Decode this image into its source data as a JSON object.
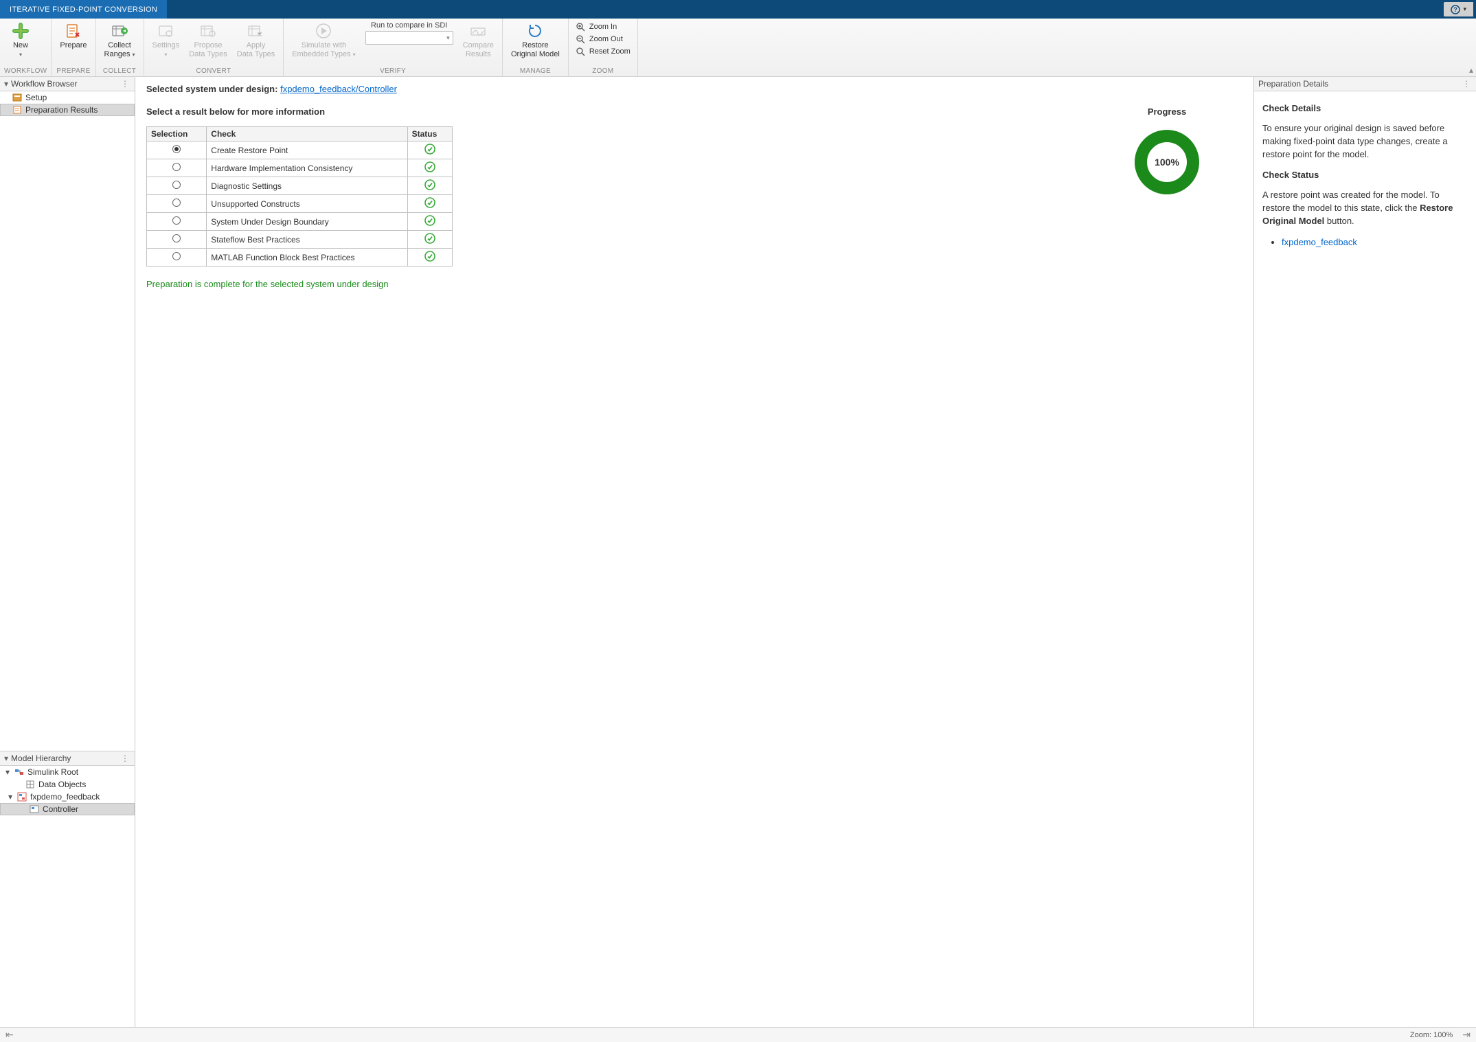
{
  "titlebar": {
    "tab": "ITERATIVE FIXED-POINT CONVERSION"
  },
  "ribbon": {
    "new": "New",
    "prepare": "Prepare",
    "collect": "Collect\nRanges",
    "settings": "Settings",
    "propose": "Propose\nData Types",
    "apply": "Apply\nData Types",
    "simulate": "Simulate with\nEmbedded Types",
    "run_compare": "Run to compare in SDI",
    "compare": "Compare\nResults",
    "restore": "Restore\nOriginal Model",
    "zoom_in": "Zoom In",
    "zoom_out": "Zoom Out",
    "reset_zoom": "Reset Zoom",
    "groups": {
      "workflow": "WORKFLOW",
      "prepare": "PREPARE",
      "collect": "COLLECT",
      "convert": "CONVERT",
      "verify": "VERIFY",
      "manage": "MANAGE",
      "zoom": "ZOOM"
    }
  },
  "workflow_browser": {
    "title": "Workflow Browser",
    "items": [
      {
        "label": "Setup",
        "selected": false
      },
      {
        "label": "Preparation Results",
        "selected": true
      }
    ]
  },
  "model_hierarchy": {
    "title": "Model Hierarchy",
    "root": "Simulink Root",
    "data_objects": "Data Objects",
    "model": "fxpdemo_feedback",
    "controller": "Controller"
  },
  "center": {
    "selected_label": "Selected system under design:",
    "selected_link": "fxpdemo_feedback/Controller",
    "select_result": "Select a result below for more information",
    "progress_title": "Progress",
    "progress_pct": "100%",
    "complete_msg": "Preparation is complete for the selected system under design",
    "table": {
      "headers": {
        "selection": "Selection",
        "check": "Check",
        "status": "Status"
      },
      "rows": [
        {
          "check": "Create Restore Point",
          "selected": true
        },
        {
          "check": "Hardware Implementation Consistency",
          "selected": false
        },
        {
          "check": "Diagnostic Settings",
          "selected": false
        },
        {
          "check": "Unsupported Constructs",
          "selected": false
        },
        {
          "check": "System Under Design Boundary",
          "selected": false
        },
        {
          "check": "Stateflow Best Practices",
          "selected": false
        },
        {
          "check": "MATLAB Function Block Best Practices",
          "selected": false
        }
      ]
    }
  },
  "right": {
    "title": "Preparation Details",
    "check_details_h": "Check Details",
    "check_details_p": "To ensure your original design is saved before making fixed-point data type changes, create a restore point for the model.",
    "check_status_h": "Check Status",
    "check_status_p1": "A restore point was created for the model. To restore the model to this state, click the ",
    "check_status_bold": "Restore Original Model",
    "check_status_p2": " button.",
    "link": "fxpdemo_feedback"
  },
  "statusbar": {
    "zoom": "Zoom: 100%"
  }
}
